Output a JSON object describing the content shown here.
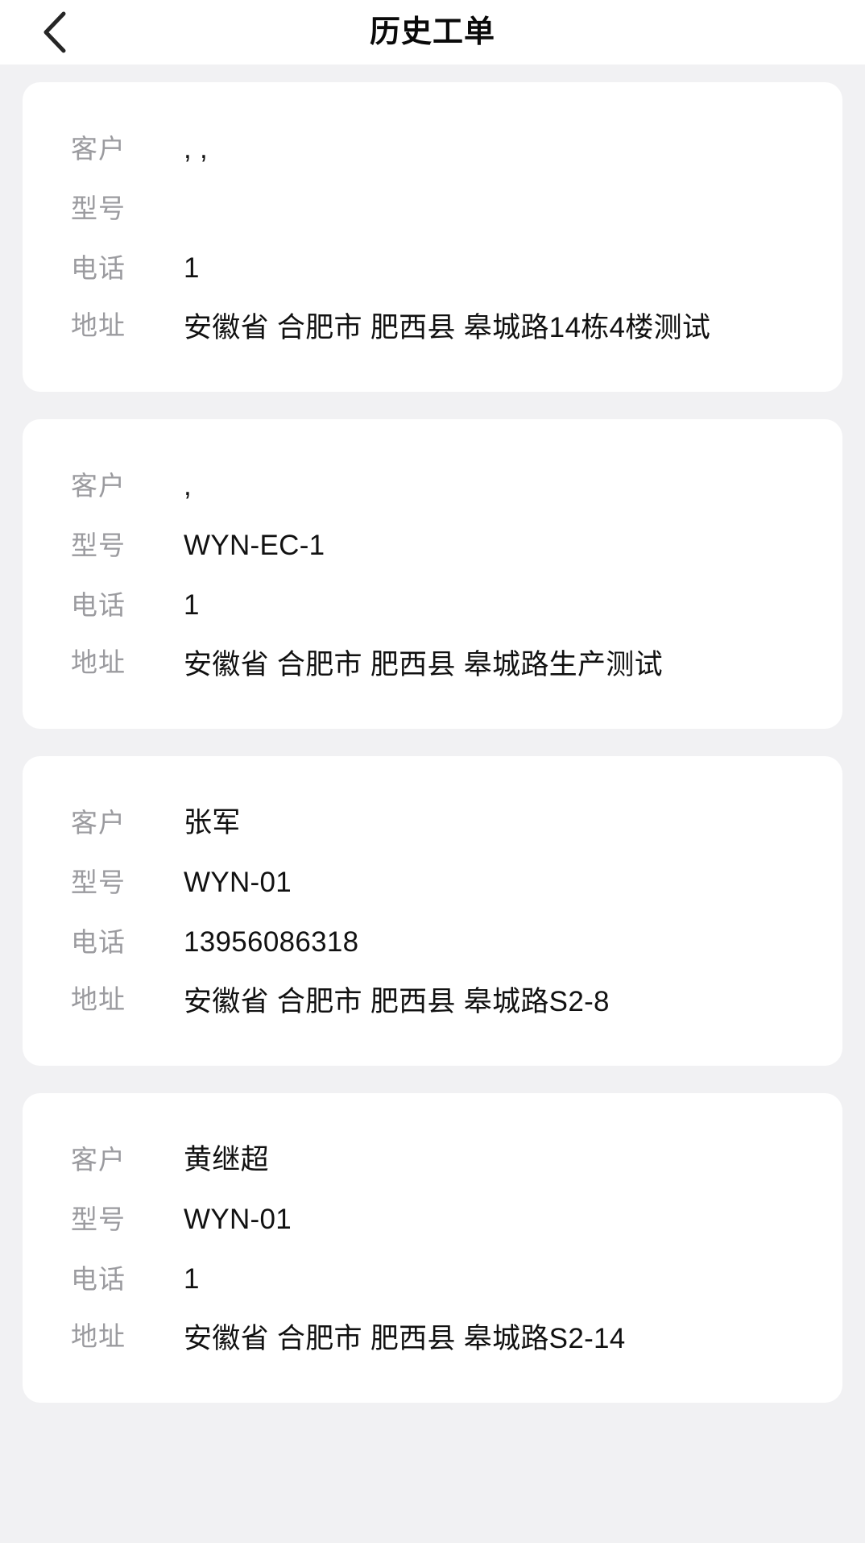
{
  "header": {
    "title": "历史工单",
    "back_icon": "chevron-left-icon"
  },
  "field_labels": {
    "customer": "客户",
    "model": "型号",
    "phone": "电话",
    "address": "地址"
  },
  "colors": {
    "page_background": "#f1f1f3",
    "card_background": "#ffffff",
    "label_text": "#9b9b9f",
    "value_text": "#111111",
    "title_text": "#0a0a0a"
  },
  "orders": [
    {
      "customer": ", ,",
      "model": "",
      "phone": "1",
      "address": "安徽省 合肥市 肥西县 皋城路14栋4楼测试"
    },
    {
      "customer": ",",
      "model": "WYN-EC-1",
      "phone": "1",
      "address": "安徽省 合肥市 肥西县 皋城路生产测试"
    },
    {
      "customer": "张军",
      "model": "WYN-01",
      "phone": "13956086318",
      "address": "安徽省 合肥市 肥西县 皋城路S2-8"
    },
    {
      "customer": "黄继超",
      "model": "WYN-01",
      "phone": "1",
      "address": "安徽省 合肥市 肥西县 皋城路S2-14"
    }
  ]
}
